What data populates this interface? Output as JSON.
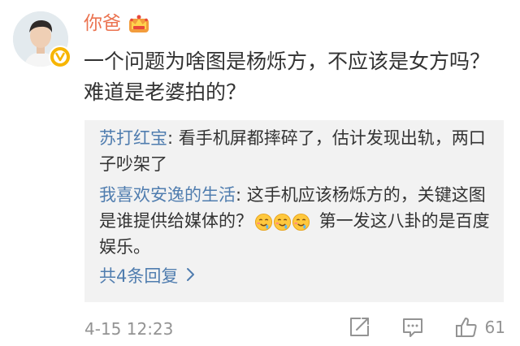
{
  "comment": {
    "username": "你爸",
    "badge_icon": "crown-icon",
    "verified_icon": "verified-badge-icon",
    "text": "一个问题为啥图是杨烁方，不应该是女方吗？难道是老婆拍的？",
    "timestamp": "4-15 12:23",
    "like_count": "61"
  },
  "replies": [
    {
      "author": "苏打红宝",
      "separator": ": ",
      "text": "看手机屏都摔碎了，估计发现出轨，两口子吵架了"
    },
    {
      "author": "我喜欢安逸的生活",
      "separator": ": ",
      "text": "这手机应该杨烁方的，关键这图是谁提供给媒体的？",
      "emojis": [
        "drooling-face-icon",
        "drooling-face-icon",
        "drooling-face-icon"
      ],
      "text_after": " 第一发这八卦的是百度娱乐。"
    }
  ],
  "more_replies": {
    "label": "共4条回复",
    "icon": "chevron-right-icon"
  },
  "colors": {
    "username": "#eb7350",
    "link_blue": "#507daf",
    "reply_bg": "#f2f2f2",
    "meta_gray": "#939393",
    "badge_yellow": "#f7b500"
  }
}
